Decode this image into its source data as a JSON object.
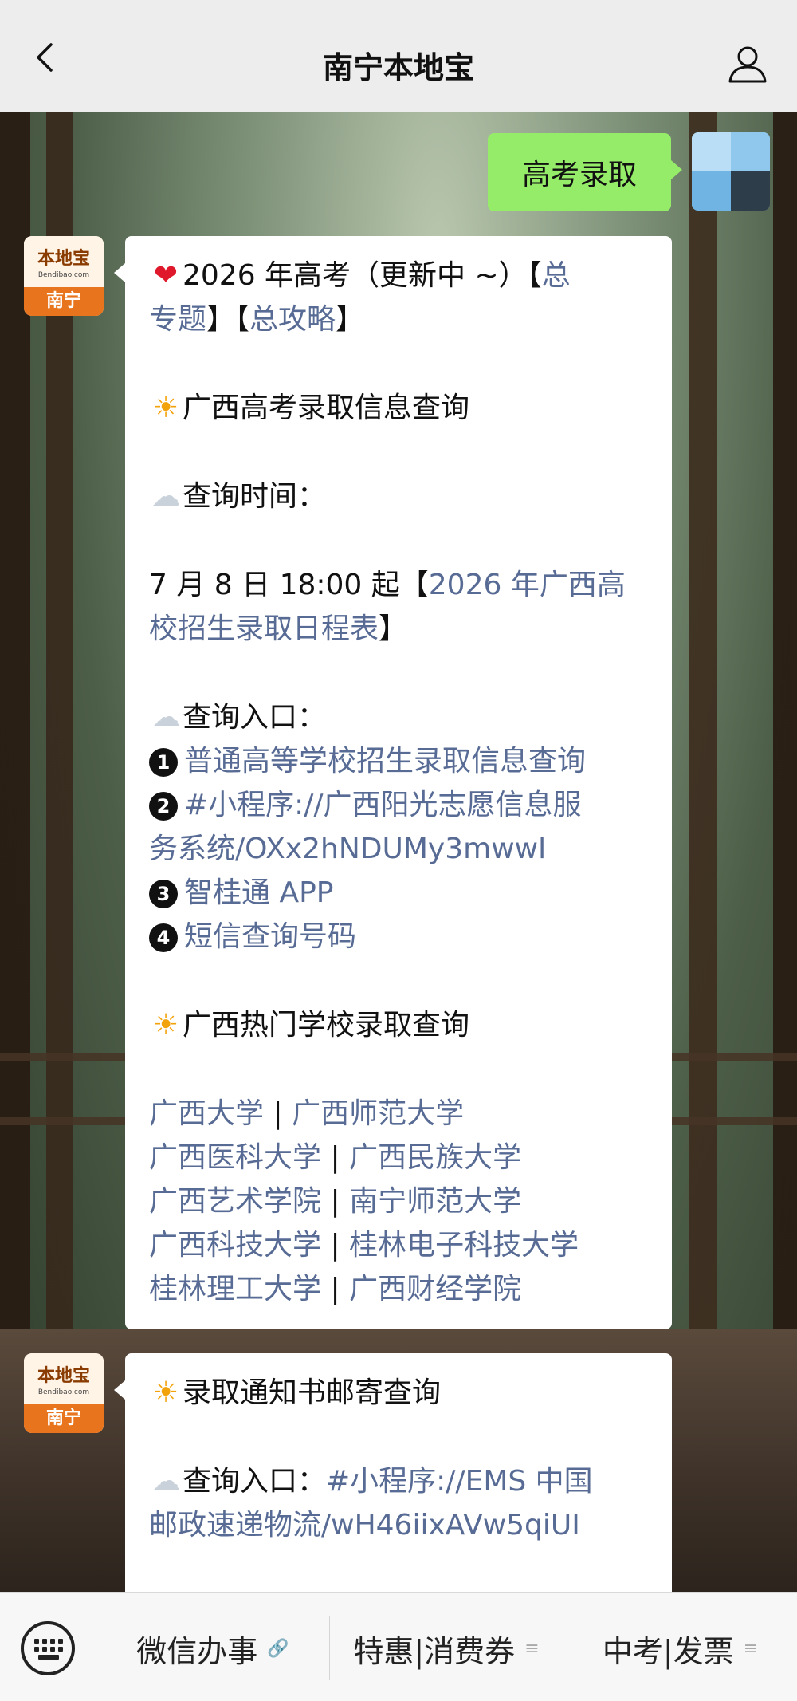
{
  "header": {
    "title": "南宁本地宝",
    "back_icon": "chevron-left-icon",
    "profile_icon": "user-icon"
  },
  "outgoing": {
    "text": "高考录取"
  },
  "message1": {
    "avatar": {
      "logo": "本地宝",
      "site": "Bendibao.com",
      "city": "南宁"
    },
    "l1_text": "2026 年高考（更新中 ~）【",
    "l1_link": "总",
    "l2_link_a": "专题",
    "l2_sep": "】【",
    "l2_link_b": "总攻略",
    "l2_end": "】",
    "h1": "广西高考录取信息查询",
    "time_label": "查询时间：",
    "time_text": "7 月 8 日 18:00 起【",
    "time_link_a": "2026 年广西高",
    "time_link_b": "校招生录取日程表",
    "time_end": "】",
    "entry_label": "查询入口：",
    "entries": [
      {
        "num": "1",
        "text": "普通高等学校招生录取信息查询"
      },
      {
        "num": "2",
        "text": "#小程序://广西阳光志愿信息服",
        "text2": "务系统/OXx2hNDUMy3mwwl"
      },
      {
        "num": "3",
        "text": "智桂通 APP"
      },
      {
        "num": "4",
        "text": "短信查询号码"
      }
    ],
    "h2": "广西热门学校录取查询",
    "schools": [
      [
        "广西大学",
        "广西师范大学"
      ],
      [
        "广西医科大学",
        "广西民族大学"
      ],
      [
        "广西艺术学院",
        "南宁师范大学"
      ],
      [
        "广西科技大学",
        "桂林电子科技大学"
      ],
      [
        "桂林理工大学",
        "广西财经学院"
      ]
    ],
    "school_sep": "|"
  },
  "message2": {
    "avatar": {
      "logo": "本地宝",
      "site": "Bendibao.com",
      "city": "南宁"
    },
    "h1": "录取通知书邮寄查询",
    "entry_label": "查询入口：",
    "entry_link_a": "#小程序://EMS 中国",
    "entry_link_b": "邮政速递物流/wH46iixAVw5qiUI"
  },
  "menu": {
    "keyboard_icon": "keyboard-icon",
    "items": [
      {
        "label": "微信办事",
        "icon": "link-icon",
        "glyph": "🔗"
      },
      {
        "label": "特惠|消费券",
        "icon": "menu-lines-icon",
        "glyph": "≡"
      },
      {
        "label": "中考|发票",
        "icon": "menu-lines-icon",
        "glyph": "≡"
      }
    ]
  },
  "colors": {
    "link": "#576b95",
    "outgoing_bubble": "#95ec69",
    "header_bg": "#ededed",
    "brand_orange": "#e8751d"
  }
}
